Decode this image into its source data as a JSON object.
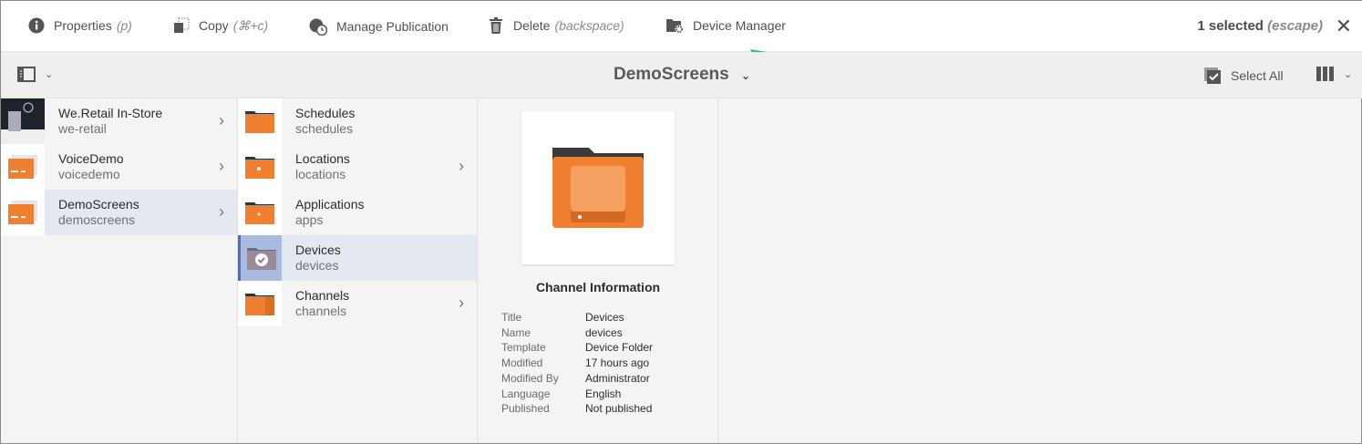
{
  "toolbar": {
    "properties": "Properties",
    "properties_hint": "(p)",
    "copy": "Copy",
    "copy_hint": "(⌘+c)",
    "manage": "Manage Publication",
    "delete": "Delete",
    "delete_hint": "(backspace)",
    "device_manager": "Device Manager",
    "selected": "1 selected",
    "selected_hint": "(escape)"
  },
  "header": {
    "title": "DemoScreens",
    "select_all": "Select All"
  },
  "col1": [
    {
      "title": "We.Retail In-Store",
      "name": "we-retail"
    },
    {
      "title": "VoiceDemo",
      "name": "voicedemo"
    },
    {
      "title": "DemoScreens",
      "name": "demoscreens"
    }
  ],
  "col2": [
    {
      "title": "Schedules",
      "name": "schedules"
    },
    {
      "title": "Locations",
      "name": "locations"
    },
    {
      "title": "Applications",
      "name": "apps"
    },
    {
      "title": "Devices",
      "name": "devices"
    },
    {
      "title": "Channels",
      "name": "channels"
    }
  ],
  "info": {
    "heading": "Channel Information",
    "rows": [
      {
        "k": "Title",
        "v": "Devices"
      },
      {
        "k": "Name",
        "v": "devices"
      },
      {
        "k": "Template",
        "v": "Device Folder"
      },
      {
        "k": "Modified",
        "v": "17 hours ago"
      },
      {
        "k": "Modified By",
        "v": "Administrator"
      },
      {
        "k": "Language",
        "v": "English"
      },
      {
        "k": "Published",
        "v": "Not published"
      }
    ]
  },
  "colors": {
    "accent": "#f0802f",
    "arrow": "#3fb59c"
  }
}
